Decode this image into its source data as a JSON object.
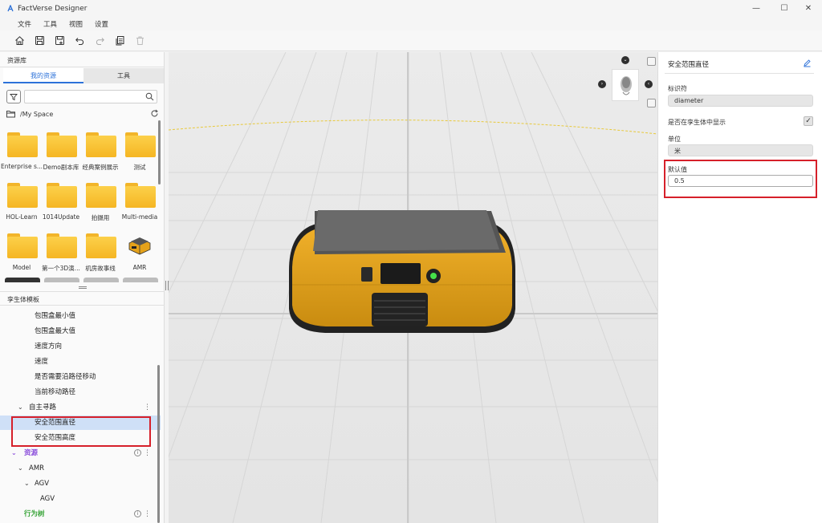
{
  "app": {
    "title": "FactVerse Designer",
    "logo_icon": "app-logo-icon"
  },
  "window": {
    "minimize": "—",
    "maximize": "☐",
    "close": "✕"
  },
  "menu": [
    "文件",
    "工具",
    "视图",
    "设置"
  ],
  "toolbar": [
    "home-icon",
    "save-icon",
    "save-as-icon",
    "undo-icon",
    "redo-icon",
    "copy-icon",
    "delete-icon"
  ],
  "left_panel": {
    "title": "资源库",
    "tabs": [
      {
        "label": "我的资源",
        "active": true
      },
      {
        "label": "工具",
        "active": false
      }
    ],
    "search_placeholder": "",
    "path": "/My Space",
    "assets": [
      {
        "label": "Enterprise s...",
        "type": "folder"
      },
      {
        "label": "Demo剧本库",
        "type": "folder"
      },
      {
        "label": "经典案例展示",
        "type": "folder"
      },
      {
        "label": "测试",
        "type": "folder"
      },
      {
        "label": "HOL-Learn",
        "type": "folder"
      },
      {
        "label": "1014Update",
        "type": "folder"
      },
      {
        "label": "拍摄用",
        "type": "folder"
      },
      {
        "label": "Multi-media",
        "type": "folder"
      },
      {
        "label": "Model",
        "type": "folder"
      },
      {
        "label": "第一个3D演...",
        "type": "folder"
      },
      {
        "label": "机房故事线",
        "type": "folder"
      },
      {
        "label": "AMR",
        "type": "model"
      }
    ]
  },
  "twin_panel": {
    "title": "孪生体模板",
    "rows": [
      {
        "label": "包围盒最小值"
      },
      {
        "label": "包围盒最大值"
      },
      {
        "label": "速度方向"
      },
      {
        "label": "速度"
      },
      {
        "label": "是否需要沿路径移动"
      },
      {
        "label": "当前移动路径"
      },
      {
        "label": "自主寻路"
      },
      {
        "label": "安全范围直径"
      },
      {
        "label": "安全范围高度"
      },
      {
        "label": "资源"
      },
      {
        "label": "AMR"
      },
      {
        "label": "AGV"
      },
      {
        "label": "AGV"
      },
      {
        "label": "行为树"
      }
    ]
  },
  "properties": {
    "title": "安全范围直径",
    "identifier_label": "标识符",
    "identifier_value": "diameter",
    "show_in_twin_label": "是否在孪生体中显示",
    "show_in_twin_checked": true,
    "unit_label": "单位",
    "unit_value": "米",
    "default_label": "默认值",
    "default_value": "0.5"
  },
  "colors": {
    "accent": "#2d72d9",
    "highlight": "#d6202a",
    "robot_body": "#e8a417",
    "green": "#3aa53a",
    "purple": "#8a4ddb"
  }
}
